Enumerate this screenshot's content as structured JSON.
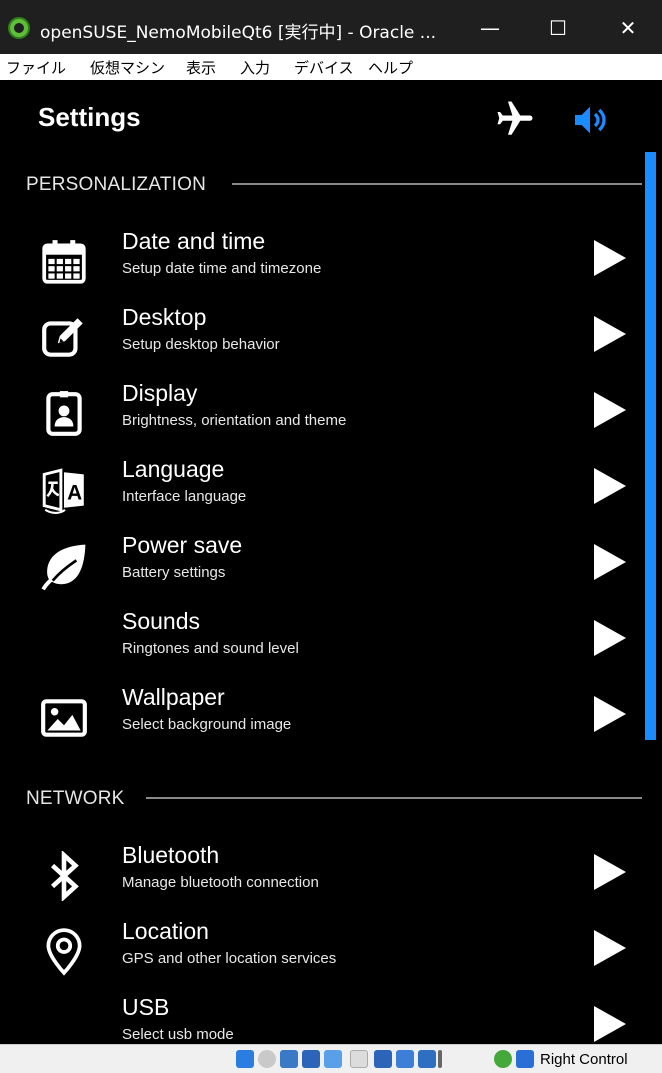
{
  "window": {
    "title": "openSUSE_NemoMobileQt6 [実行中] - Oracle ...",
    "minimize_label": "—",
    "maximize_label": "☐",
    "close_label": "✕"
  },
  "menubar": {
    "items": [
      {
        "label": "ファイル"
      },
      {
        "label": "仮想マシン"
      },
      {
        "label": "表示"
      },
      {
        "label": "入力"
      },
      {
        "label": "デバイス"
      },
      {
        "label": "ヘルプ"
      }
    ]
  },
  "header": {
    "title": "Settings",
    "airplane_icon": "airplane-icon",
    "volume_icon": "volume-icon",
    "accent_color": "#1a8cff"
  },
  "sections": {
    "personalization": "PERSONALIZATION",
    "network": "NETWORK"
  },
  "items": [
    {
      "label": "Date and time",
      "description": "Setup date time and timezone",
      "icon": "calendar-icon"
    },
    {
      "label": "Desktop",
      "description": "Setup desktop behavior",
      "icon": "edit-icon"
    },
    {
      "label": "Display",
      "description": "Brightness, orientation and theme",
      "icon": "display-icon"
    },
    {
      "label": "Language",
      "description": "Interface language",
      "icon": "language-icon"
    },
    {
      "label": "Power save",
      "description": "Battery settings",
      "icon": "leaf-icon"
    },
    {
      "label": "Sounds",
      "description": "Ringtones and sound level",
      "icon": ""
    },
    {
      "label": "Wallpaper",
      "description": "Select background image",
      "icon": "image-icon"
    },
    {
      "label": "Bluetooth",
      "description": "Manage bluetooth connection",
      "icon": "bluetooth-icon"
    },
    {
      "label": "Location",
      "description": "GPS and other location services",
      "icon": "location-icon"
    },
    {
      "label": "USB",
      "description": "Select usb mode",
      "icon": ""
    }
  ],
  "statusbar": {
    "host_key": "Right Control"
  }
}
